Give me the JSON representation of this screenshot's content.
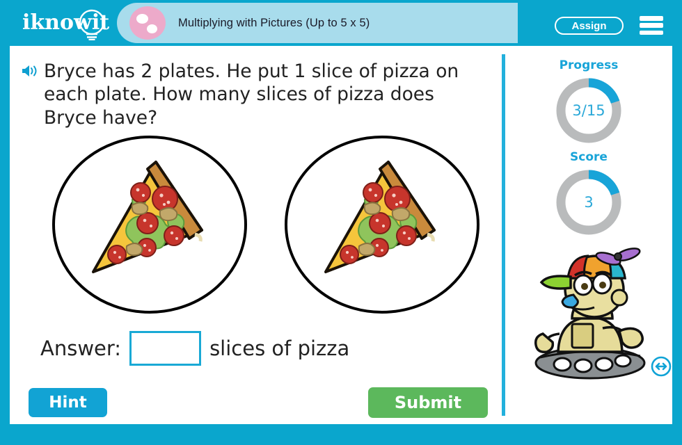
{
  "brand": {
    "logo_text": "iknowit",
    "logo_icon": "lightbulb-icon"
  },
  "header": {
    "topic_icon": "two-dots-circle-icon",
    "title": "Multiplying with Pictures (Up to 5 x 5)",
    "assign_label": "Assign",
    "menu_icon": "hamburger-menu-icon",
    "background_color": "#0aa6cd",
    "title_pill_color": "#a8dcec"
  },
  "question": {
    "audio_icon": "speaker-icon",
    "text": "Bryce has 2 plates. He put 1 slice of pizza on each plate. How many slices of pizza does Bryce have?"
  },
  "illustration": {
    "item_icon": "pizza-slice-icon",
    "container_icon": "plate-icon",
    "plate_count": 2,
    "items_per_plate": 1,
    "plates": [
      {
        "label": "plate-1",
        "slices": 1
      },
      {
        "label": "plate-2",
        "slices": 1
      }
    ]
  },
  "answer": {
    "label": "Answer:",
    "value": "",
    "placeholder": "",
    "unit": "slices of pizza",
    "border_color": "#19a9d5"
  },
  "actions": {
    "hint_label": "Hint",
    "hint_color": "#12a3d4",
    "submit_label": "Submit",
    "submit_color": "#5cb85c"
  },
  "sidebar": {
    "progress": {
      "label": "Progress",
      "value": "3/15",
      "current": 3,
      "total": 15,
      "percent": 20
    },
    "score": {
      "label": "Score",
      "value": "3",
      "current": 3,
      "percent": 20
    },
    "accent_color": "#18a4d8",
    "track_color": "#b9bbbc",
    "mascot_icon": "robot-mascot-icon",
    "resize_icon": "left-right-arrows-icon"
  }
}
